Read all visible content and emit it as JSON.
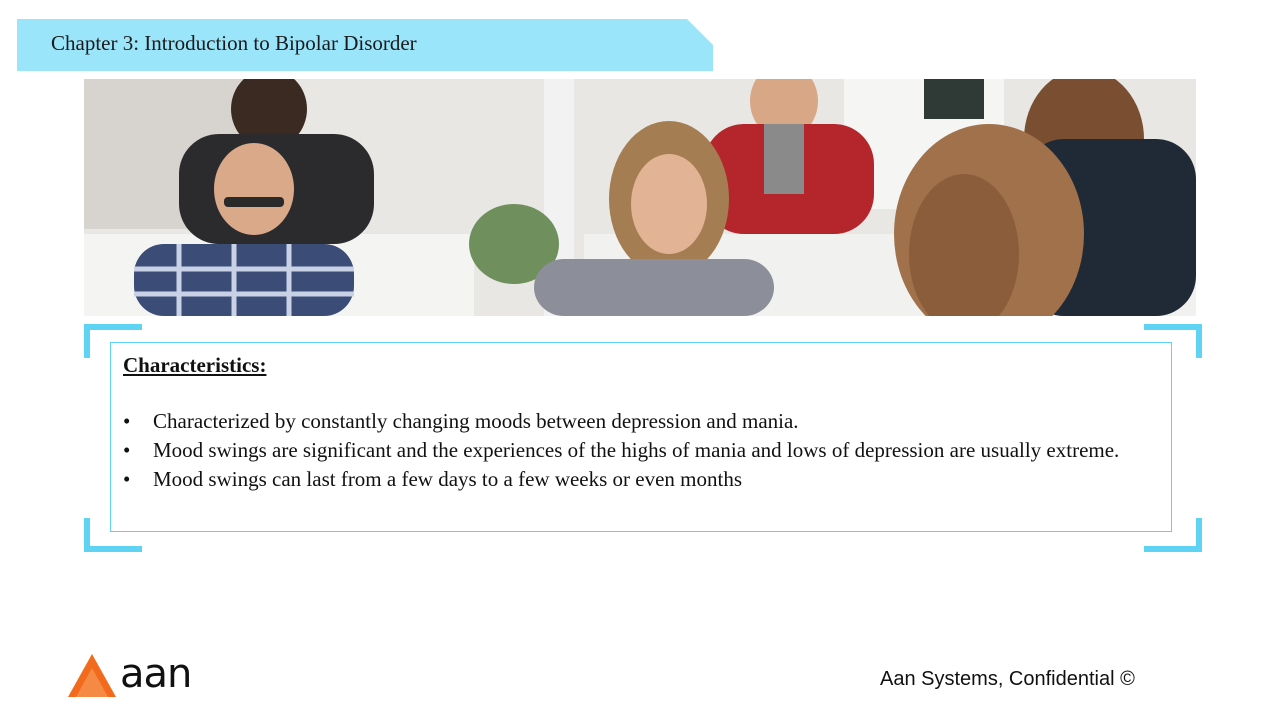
{
  "header": {
    "title": "Chapter 3: Introduction to Bipolar Disorder"
  },
  "content": {
    "heading": "Characteristics:",
    "bullets": [
      "Characterized by constantly changing moods between depression and mania.",
      "Mood swings are significant and the experiences of the highs of mania and lows of depression are usually extreme.",
      "Mood swings can last from a few days to a few weeks or even months"
    ],
    "bullet_glyph": "•"
  },
  "footer": {
    "logo_text": "aan",
    "copyright": "Aan Systems, Confidential ©"
  },
  "colors": {
    "banner": "#9be5fb",
    "frame": "#5fd3f3",
    "logo_orange": "#f26b1d"
  },
  "icons": {
    "logo": "triangle-logo-icon",
    "photo": "group-meeting-photo"
  }
}
